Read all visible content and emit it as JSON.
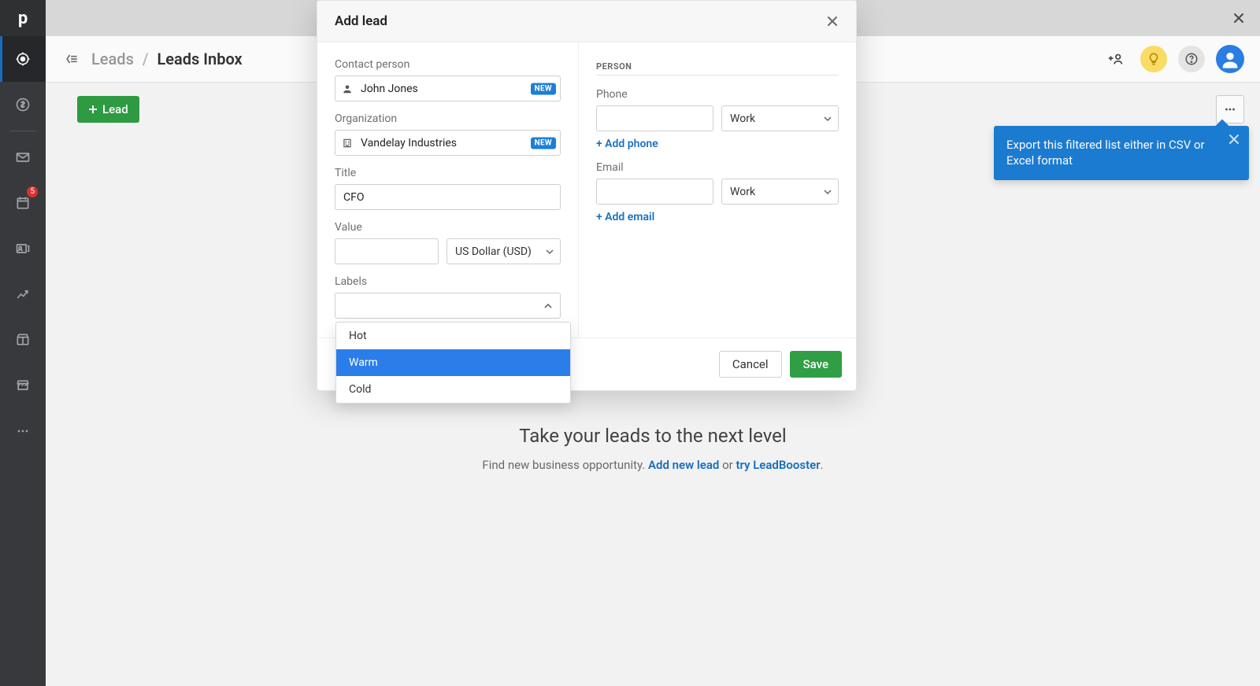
{
  "global": {
    "close_icon": "close"
  },
  "leftnav": {
    "logo_letter": "p",
    "calendar_badge": "5"
  },
  "header": {
    "crumb1": "Leads",
    "crumb2": "Leads Inbox"
  },
  "toolbar": {
    "lead_button": "Lead"
  },
  "tooltip": {
    "text": "Export this filtered list either in CSV or Excel format"
  },
  "empty": {
    "title": "Take your leads to the next level",
    "prefix": "Find new business opportunity. ",
    "link1": "Add new lead",
    "mid": " or ",
    "link2": "try LeadBooster",
    "suffix": "."
  },
  "modal": {
    "title": "Add lead",
    "contact_label": "Contact person",
    "contact_value": "John Jones",
    "new_badge": "NEW",
    "org_label": "Organization",
    "org_value": "Vandelay Industries",
    "title_label": "Title",
    "title_value": "CFO",
    "value_label": "Value",
    "value_value": "",
    "currency": "US Dollar (USD)",
    "labels_label": "Labels",
    "labels_options": {
      "0": "Hot",
      "1": "Warm",
      "2": "Cold"
    },
    "person_section": "PERSON",
    "phone_label": "Phone",
    "phone_value": "",
    "phone_type": "Work",
    "add_phone": "+ Add phone",
    "email_label": "Email",
    "email_value": "",
    "email_type": "Work",
    "add_email": "+ Add email",
    "cancel": "Cancel",
    "save": "Save"
  }
}
